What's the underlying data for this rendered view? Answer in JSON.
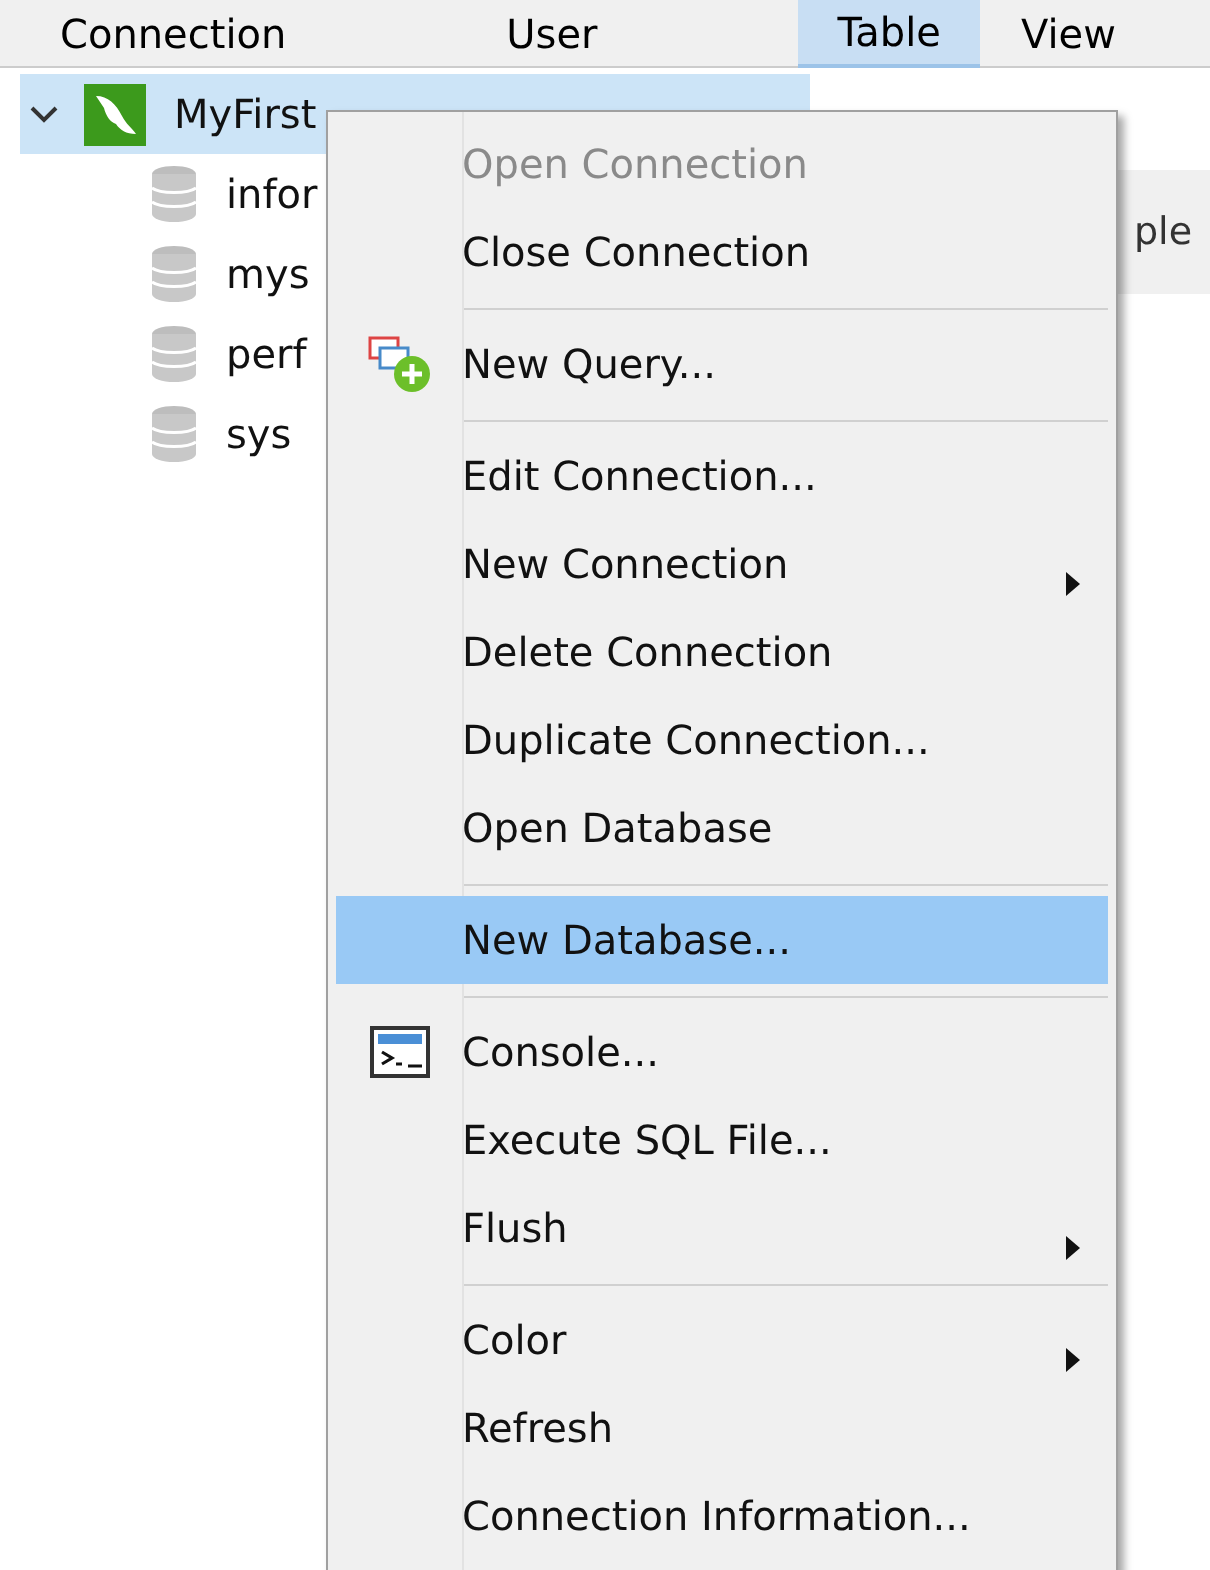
{
  "header_tabs": [
    {
      "label": "Connection",
      "selected": false
    },
    {
      "label": "User",
      "selected": false
    },
    {
      "label": "Table",
      "selected": true
    },
    {
      "label": "View",
      "selected": false
    }
  ],
  "tree": {
    "label": "MyFirst",
    "expanded": true,
    "selected": true,
    "children": [
      {
        "label": "infor"
      },
      {
        "label": "mys"
      },
      {
        "label": "perf"
      },
      {
        "label": "sys"
      }
    ]
  },
  "background_text": "ple",
  "context_menu": [
    {
      "kind": "item",
      "label": "Open Connection",
      "disabled": true,
      "selected": false
    },
    {
      "kind": "item",
      "label": "Close Connection",
      "disabled": false,
      "selected": false
    },
    {
      "kind": "separator"
    },
    {
      "kind": "query",
      "label": "New Query...",
      "disabled": false,
      "selected": false
    },
    {
      "kind": "separator"
    },
    {
      "kind": "item",
      "label": "Edit Connection...",
      "disabled": false,
      "selected": false
    },
    {
      "kind": "item",
      "label": "New Connection",
      "disabled": false,
      "selected": false,
      "submenu": true
    },
    {
      "kind": "item",
      "label": "Delete Connection",
      "disabled": false,
      "selected": false
    },
    {
      "kind": "item",
      "label": "Duplicate Connection...",
      "disabled": false,
      "selected": false
    },
    {
      "kind": "item",
      "label": "Open Database",
      "disabled": false,
      "selected": false
    },
    {
      "kind": "separator"
    },
    {
      "kind": "item",
      "label": "New Database...",
      "disabled": false,
      "selected": true
    },
    {
      "kind": "separator"
    },
    {
      "kind": "console",
      "label": "Console...",
      "disabled": false,
      "selected": false
    },
    {
      "kind": "item",
      "label": "Execute SQL File...",
      "disabled": false,
      "selected": false
    },
    {
      "kind": "item",
      "label": "Flush",
      "disabled": false,
      "selected": false,
      "submenu": true
    },
    {
      "kind": "separator"
    },
    {
      "kind": "item",
      "label": "Color",
      "disabled": false,
      "selected": false,
      "submenu": true
    },
    {
      "kind": "item",
      "label": "Refresh",
      "disabled": false,
      "selected": false
    },
    {
      "kind": "item",
      "label": "Connection Information...",
      "disabled": false,
      "selected": false
    }
  ]
}
